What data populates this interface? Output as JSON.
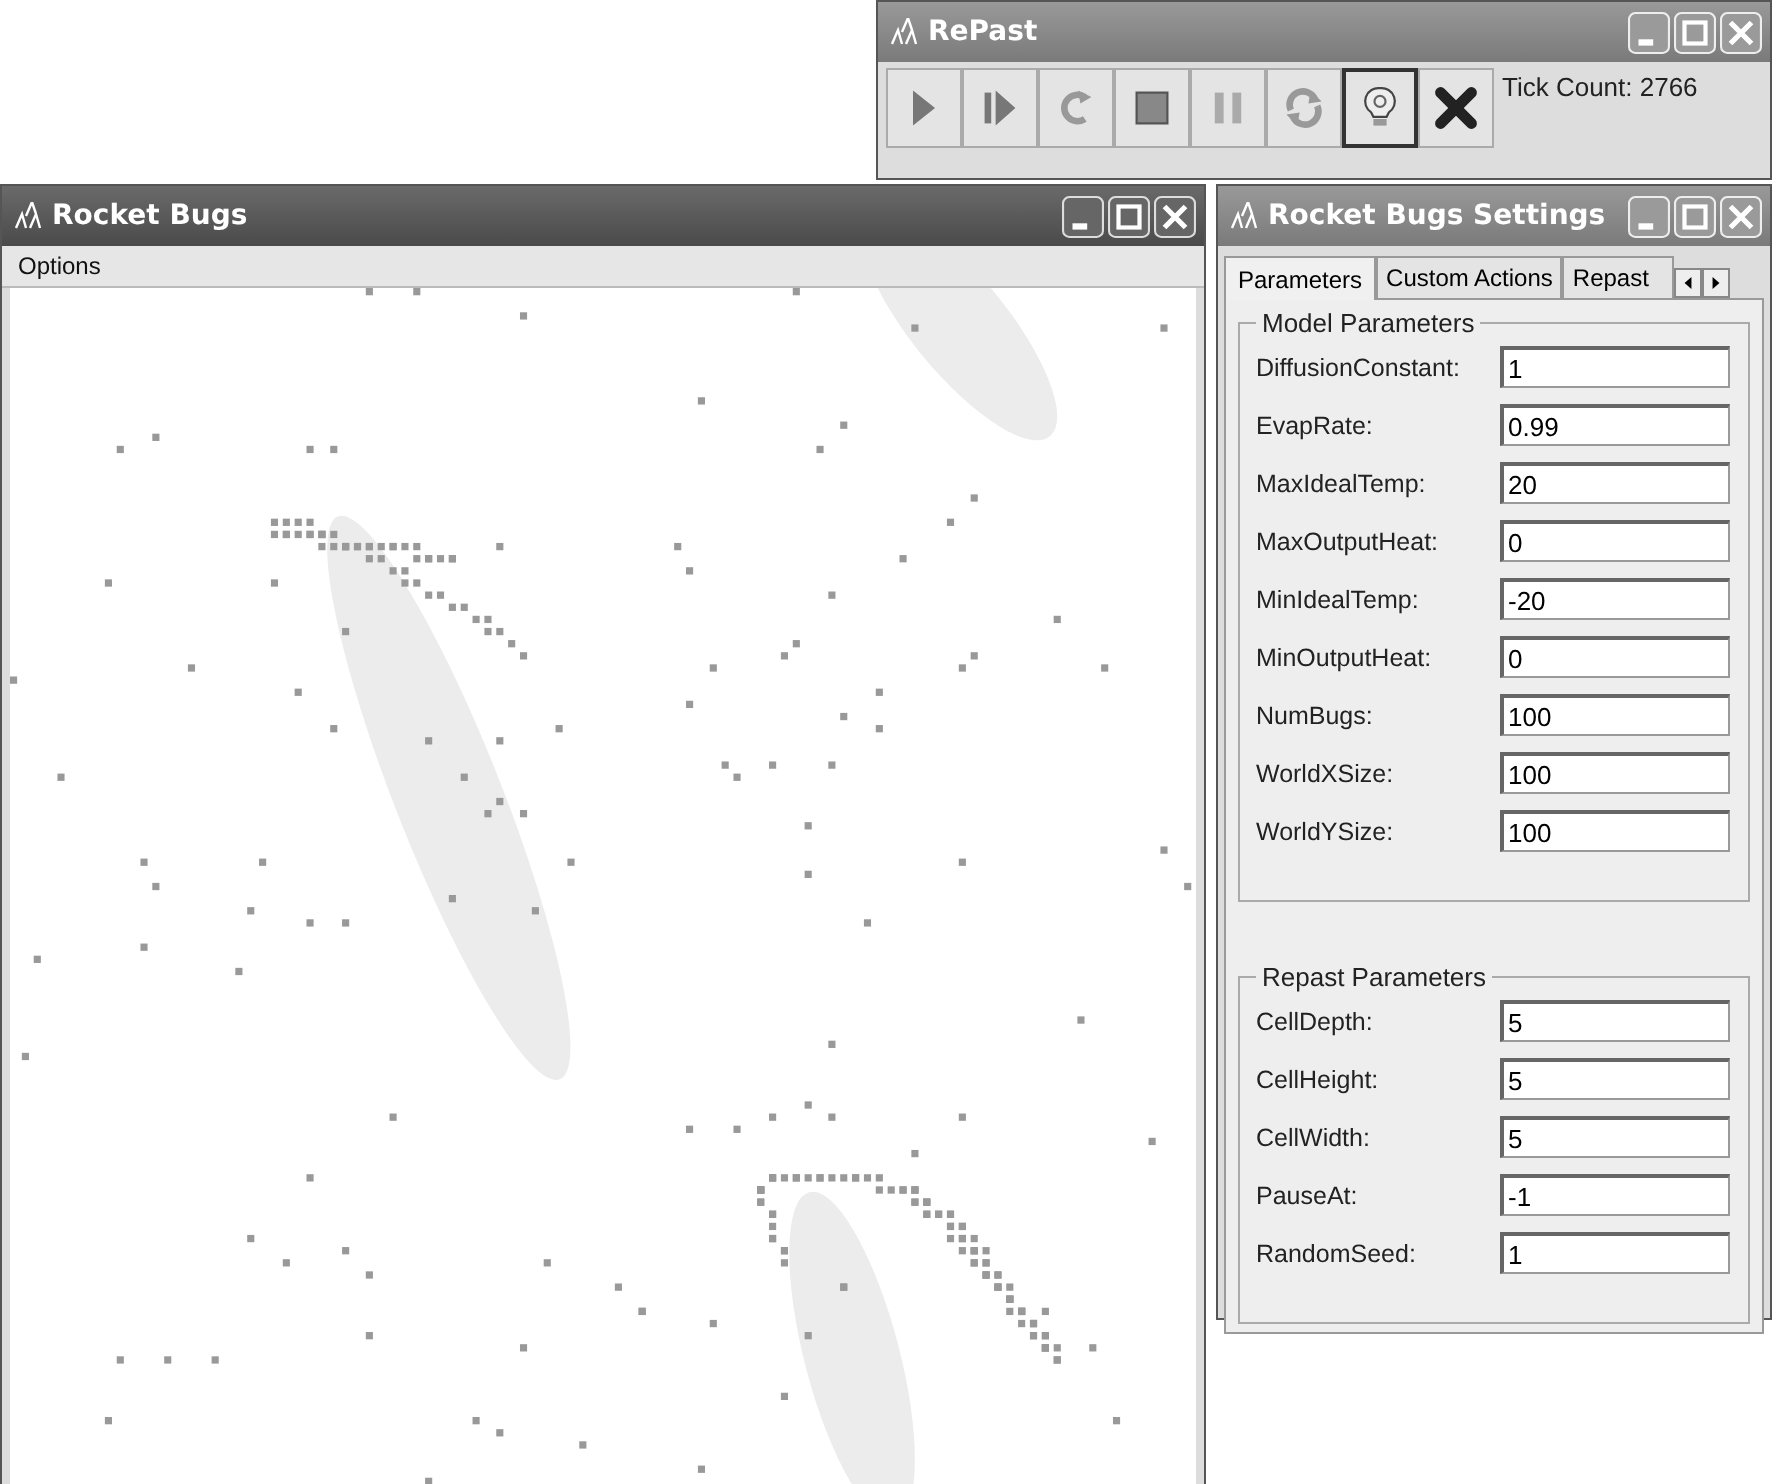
{
  "repast_window": {
    "title": "RePast",
    "toolbar": [
      {
        "kind": "play",
        "selected": false
      },
      {
        "kind": "step",
        "selected": false
      },
      {
        "kind": "reset",
        "selected": false
      },
      {
        "kind": "stop",
        "selected": false
      },
      {
        "kind": "pause",
        "selected": false
      },
      {
        "kind": "loop",
        "selected": false
      },
      {
        "kind": "info",
        "selected": true
      },
      {
        "kind": "exit",
        "selected": false
      }
    ],
    "tick_count": "Tick Count: 2766"
  },
  "model_window": {
    "title": "Rocket Bugs",
    "menu": [
      "Options"
    ]
  },
  "settings_window": {
    "title": "Rocket Bugs Settings",
    "tabs": [
      {
        "label": "Parameters",
        "selected": true
      },
      {
        "label": "Custom Actions",
        "selected": false
      },
      {
        "label": "Repast",
        "selected": false
      }
    ],
    "groups": [
      {
        "title": "Model Parameters",
        "fields": [
          {
            "label": "DiffusionConstant:",
            "value": "1"
          },
          {
            "label": "EvapRate:",
            "value": "0.99"
          },
          {
            "label": "MaxIdealTemp:",
            "value": "20"
          },
          {
            "label": "MaxOutputHeat:",
            "value": "0"
          },
          {
            "label": "MinIdealTemp:",
            "value": "-20"
          },
          {
            "label": "MinOutputHeat:",
            "value": "0"
          },
          {
            "label": "NumBugs:",
            "value": "100"
          },
          {
            "label": "WorldXSize:",
            "value": "100"
          },
          {
            "label": "WorldYSize:",
            "value": "100"
          }
        ]
      },
      {
        "title": "Repast Parameters",
        "fields": [
          {
            "label": "CellDepth:",
            "value": "5"
          },
          {
            "label": "CellHeight:",
            "value": "5"
          },
          {
            "label": "CellWidth:",
            "value": "5"
          },
          {
            "label": "PauseAt:",
            "value": "-1"
          },
          {
            "label": "RandomSeed:",
            "value": "1"
          }
        ]
      }
    ]
  }
}
